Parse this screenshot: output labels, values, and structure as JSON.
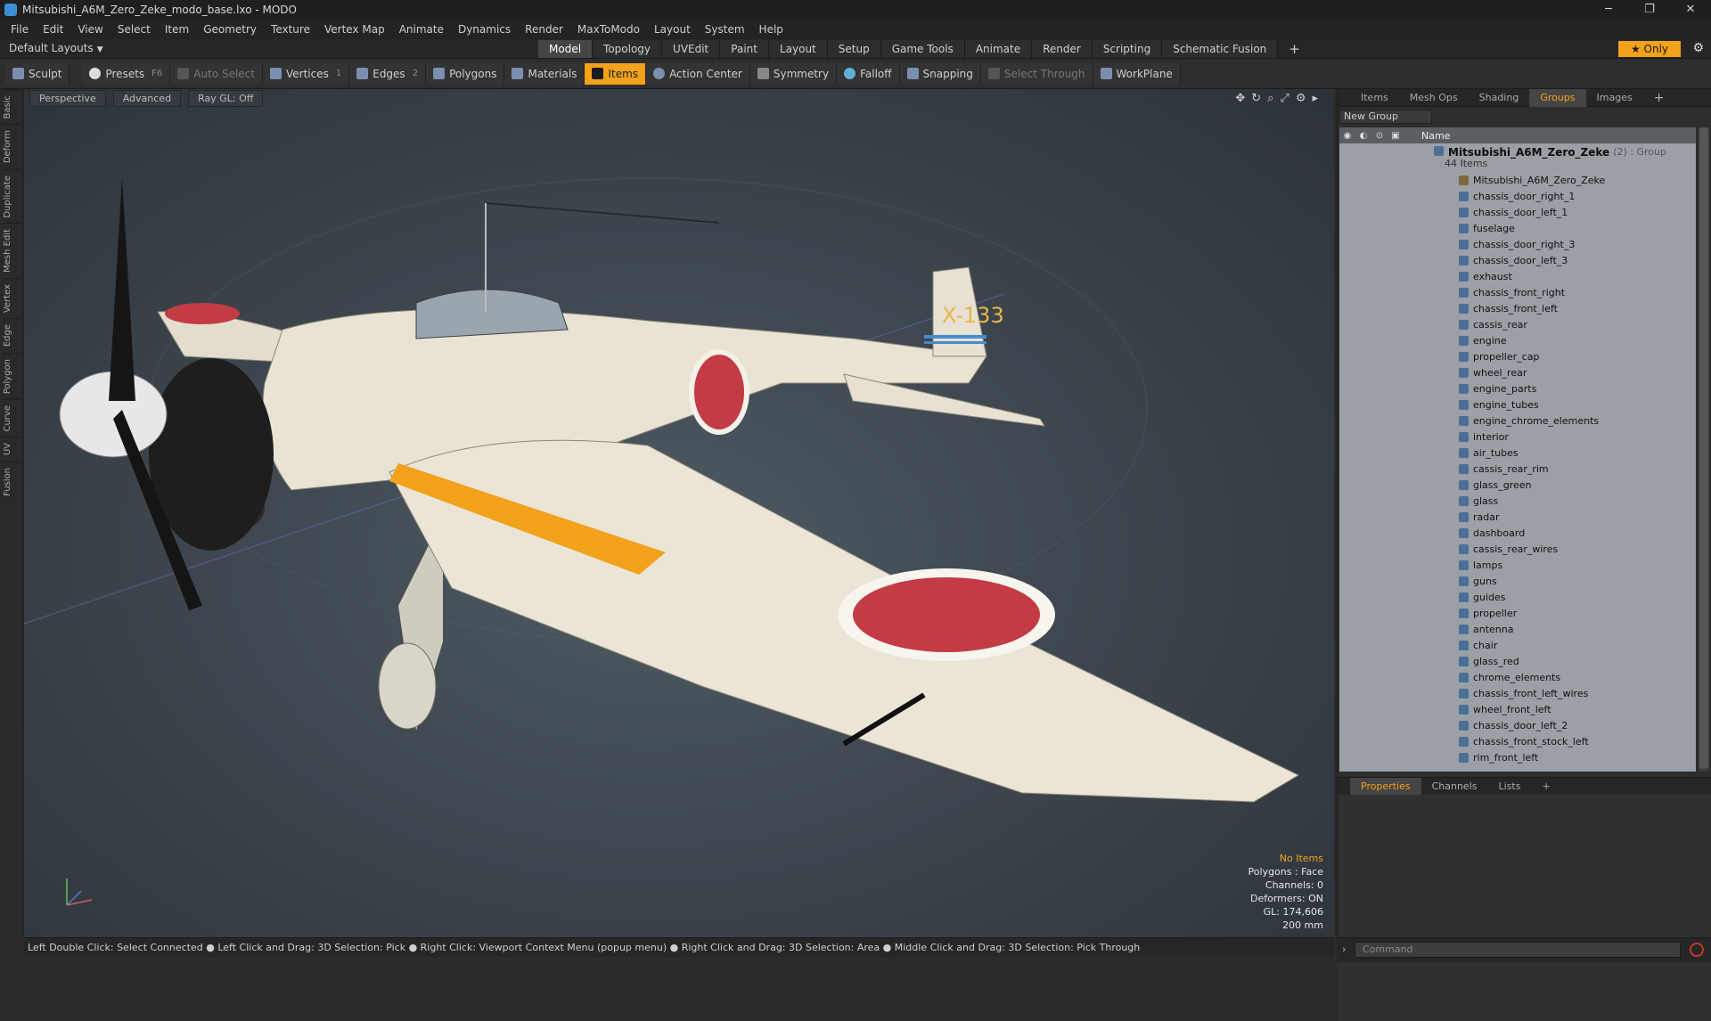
{
  "window": {
    "title": "Mitsubishi_A6M_Zero_Zeke_modo_base.lxo - MODO",
    "controls": [
      "─",
      "❐",
      "✕"
    ]
  },
  "menu": [
    "File",
    "Edit",
    "View",
    "Select",
    "Item",
    "Geometry",
    "Texture",
    "Vertex Map",
    "Animate",
    "Dynamics",
    "Render",
    "MaxToModo",
    "Layout",
    "System",
    "Help"
  ],
  "layout": {
    "preset": "Default Layouts",
    "tabs": [
      "Model",
      "Topology",
      "UVEdit",
      "Paint",
      "Layout",
      "Setup",
      "Game Tools",
      "Animate",
      "Render",
      "Scripting",
      "Schematic Fusion"
    ],
    "active_tab": "Model",
    "plus": "+",
    "only_label": "★  Only"
  },
  "toolbar": {
    "sculpt": "Sculpt",
    "presets": "Presets",
    "presets_key": "F6",
    "auto_select": "Auto Select",
    "vertices": "Vertices",
    "vertices_key": "1",
    "edges": "Edges",
    "edges_key": "2",
    "polygons": "Polygons",
    "materials": "Materials",
    "items": "Items",
    "action_center": "Action Center",
    "symmetry": "Symmetry",
    "falloff": "Falloff",
    "snapping": "Snapping",
    "select_through": "Select Through",
    "workplane": "WorkPlane"
  },
  "left_strip": [
    "Basic",
    "Deform",
    "Duplicate",
    "Mesh Edit",
    "Vertex",
    "Edge",
    "Polygon",
    "Curve",
    "UV",
    "Fusion"
  ],
  "viewport": {
    "view": "Perspective",
    "shading": "Advanced",
    "raygl": "Ray GL: Off",
    "hud": {
      "no_items": "No Items",
      "polygons": "Polygons : Face",
      "channels": "Channels: 0",
      "deformers": "Deformers: ON",
      "gl": "GL: 174,606",
      "size": "200 mm"
    },
    "plane_tail_text": "X-133"
  },
  "status": "Left Double Click: Select Connected ● Left Click and Drag: 3D Selection: Pick ● Right Click: Viewport Context Menu (popup menu) ● Right Click and Drag: 3D Selection: Area ● Middle Click and Drag: 3D Selection: Pick Through",
  "right_panel": {
    "tabs": [
      "Items",
      "Mesh Ops",
      "Shading",
      "Groups",
      "Images"
    ],
    "active_tab": "Groups",
    "new_group": "New Group",
    "name_header": "Name",
    "group": {
      "name": "Mitsubishi_A6M_Zero_Zeke",
      "meta": "(2) : Group",
      "count": "44 Items"
    },
    "locator": "Mitsubishi_A6M_Zero_Zeke",
    "items": [
      "chassis_door_right_1",
      "chassis_door_left_1",
      "fuselage",
      "chassis_door_right_3",
      "chassis_door_left_3",
      "exhaust",
      "chassis_front_right",
      "chassis_front_left",
      "cassis_rear",
      "engine",
      "propeller_cap",
      "wheel_rear",
      "engine_parts",
      "engine_tubes",
      "engine_chrome_elements",
      "interior",
      "air_tubes",
      "cassis_rear_rim",
      "glass_green",
      "glass",
      "radar",
      "dashboard",
      "cassis_rear_wires",
      "lamps",
      "guns",
      "guides",
      "propeller",
      "antenna",
      "chair",
      "glass_red",
      "chrome_elements",
      "chassis_front_left_wires",
      "wheel_front_left",
      "chassis_door_left_2",
      "chassis_front_stock_left",
      "rim_front_left"
    ],
    "bottom_tabs": [
      "Properties",
      "Channels",
      "Lists"
    ],
    "bottom_active": "Properties",
    "command_placeholder": "Command"
  }
}
